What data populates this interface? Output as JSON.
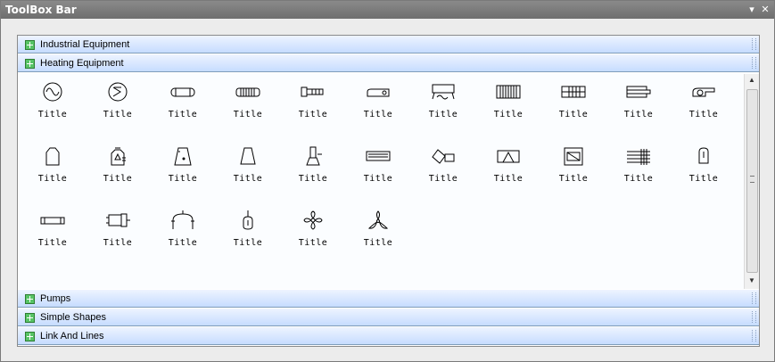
{
  "window": {
    "title": "ToolBox Bar",
    "pin_symbol": "▾",
    "close_symbol": "✕"
  },
  "sections_top": [
    {
      "label": "Industrial Equipment",
      "icon": "plus-square-icon"
    },
    {
      "label": "Heating Equipment",
      "icon": "plus-square-icon"
    }
  ],
  "items": [
    {
      "caption": "Title",
      "icon": "sine-wave-circle-icon"
    },
    {
      "caption": "Title",
      "icon": "sum-circle-icon"
    },
    {
      "caption": "Title",
      "icon": "cylinder-horizontal-icon"
    },
    {
      "caption": "Title",
      "icon": "ribbed-cylinder-icon"
    },
    {
      "caption": "Title",
      "icon": "bolt-valve-icon"
    },
    {
      "caption": "Title",
      "icon": "tank-truck-icon"
    },
    {
      "caption": "Title",
      "icon": "bench-heater-icon"
    },
    {
      "caption": "Title",
      "icon": "striped-block-icon"
    },
    {
      "caption": "Title",
      "icon": "grid-block-icon"
    },
    {
      "caption": "Title",
      "icon": "stacked-tube-icon"
    },
    {
      "caption": "Title",
      "icon": "blower-icon"
    },
    {
      "caption": "Title",
      "icon": "furnace-icon"
    },
    {
      "caption": "Title",
      "icon": "kiln-icon"
    },
    {
      "caption": "Title",
      "icon": "trapezoid-dot-icon"
    },
    {
      "caption": "Title",
      "icon": "trapezoid-icon"
    },
    {
      "caption": "Title",
      "icon": "pipe-stand-icon"
    },
    {
      "caption": "Title",
      "icon": "panel-heater-icon"
    },
    {
      "caption": "Title",
      "icon": "rotated-drum-icon"
    },
    {
      "caption": "Title",
      "icon": "triangle-box-icon"
    },
    {
      "caption": "Title",
      "icon": "window-box-icon"
    },
    {
      "caption": "Title",
      "icon": "coil-grid-icon"
    },
    {
      "caption": "Title",
      "icon": "tag-icon"
    },
    {
      "caption": "Title",
      "icon": "long-cylinder-icon"
    },
    {
      "caption": "Title",
      "icon": "valve-block-icon"
    },
    {
      "caption": "Title",
      "icon": "arch-vessel-icon"
    },
    {
      "caption": "Title",
      "icon": "lamp-icon"
    },
    {
      "caption": "Title",
      "icon": "four-blade-fan-icon"
    },
    {
      "caption": "Title",
      "icon": "three-blade-fan-icon"
    }
  ],
  "sections_bottom": [
    {
      "label": "Pumps",
      "icon": "plus-square-icon"
    },
    {
      "label": "Simple Shapes",
      "icon": "plus-square-icon"
    },
    {
      "label": "Link And Lines",
      "icon": "plus-square-icon"
    }
  ]
}
